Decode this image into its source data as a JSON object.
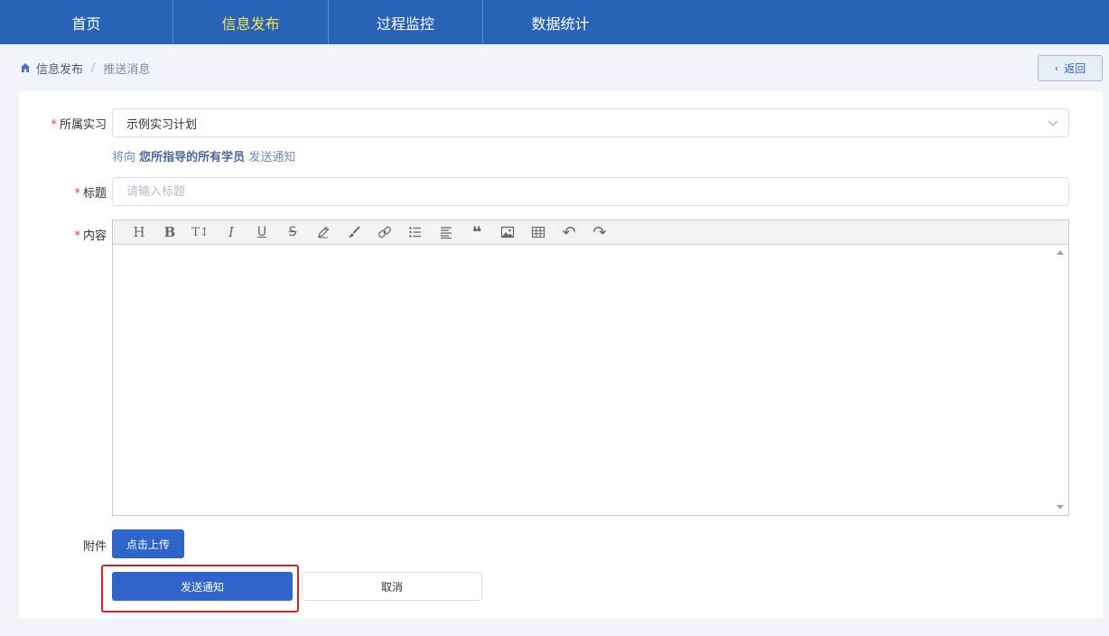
{
  "topnav": {
    "items": [
      {
        "label": "首页",
        "active": false
      },
      {
        "label": "信息发布",
        "active": true
      },
      {
        "label": "过程监控",
        "active": false
      },
      {
        "label": "数据统计",
        "active": false
      }
    ],
    "background": "#2963b6",
    "active_color": "#f6e35a"
  },
  "breadcrumb": {
    "home_icon": "home-icon",
    "parent": "信息发布",
    "separator": "/",
    "current": "推送消息"
  },
  "back_button": {
    "icon": "chevron-left-icon",
    "label": "返回"
  },
  "form": {
    "internship": {
      "required_mark": "*",
      "label": "所属实习",
      "value": "示例实习计划",
      "hint_prefix": "将向",
      "hint_target": "您所指导的所有学员",
      "hint_suffix": "发送通知"
    },
    "title": {
      "required_mark": "*",
      "label": "标题",
      "value": "",
      "placeholder": "请输入标题"
    },
    "content": {
      "required_mark": "*",
      "label": "内容",
      "toolbar": [
        {
          "icon": "heading-icon",
          "glyph": "H"
        },
        {
          "icon": "bold-icon",
          "glyph": "B"
        },
        {
          "icon": "text-size-icon",
          "glyph": "T↕"
        },
        {
          "icon": "italic-icon",
          "glyph": "I"
        },
        {
          "icon": "underline-icon",
          "glyph": "U"
        },
        {
          "icon": "strikethrough-icon",
          "glyph": "S"
        },
        {
          "icon": "pencil-icon",
          "glyph": ""
        },
        {
          "icon": "brush-icon",
          "glyph": ""
        },
        {
          "icon": "link-icon",
          "glyph": ""
        },
        {
          "icon": "list-icon",
          "glyph": ""
        },
        {
          "icon": "align-left-icon",
          "glyph": ""
        },
        {
          "icon": "quote-icon",
          "glyph": "❝"
        },
        {
          "icon": "image-icon",
          "glyph": ""
        },
        {
          "icon": "table-icon",
          "glyph": ""
        },
        {
          "icon": "undo-icon",
          "glyph": "↶"
        },
        {
          "icon": "redo-icon",
          "glyph": "↷"
        }
      ]
    },
    "attachment": {
      "label": "附件",
      "upload_label": "点击上传"
    },
    "submit_label": "发送通知",
    "cancel_label": "取消",
    "highlight_color": "#e0201e",
    "primary_color": "#2f65c8"
  }
}
